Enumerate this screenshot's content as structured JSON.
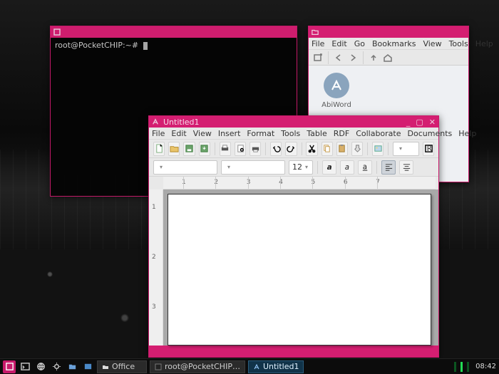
{
  "terminal": {
    "title_icon": "terminal-icon",
    "prompt": "root@PocketCHIP:~#"
  },
  "file_manager": {
    "menu": [
      "File",
      "Edit",
      "Go",
      "Bookmarks",
      "View",
      "Tools",
      "Help"
    ],
    "icons": {
      "app_label": "AbiWord"
    }
  },
  "abiword": {
    "title": "Untitled1",
    "menu": [
      "File",
      "Edit",
      "View",
      "Insert",
      "Format",
      "Tools",
      "Table",
      "RDF",
      "Collaborate",
      "Documents",
      "Help"
    ],
    "style_combo": "",
    "font_combo": "",
    "size_combo": "12",
    "zoom_combo": "",
    "status": {
      "mode": "",
      "lang": "",
      "ins": ""
    }
  },
  "ruler": {
    "marks": [
      1,
      2,
      3,
      4,
      5,
      6,
      7
    ]
  },
  "vruler": {
    "marks": [
      1,
      2,
      3
    ]
  },
  "panel": {
    "tasks": [
      {
        "label": "Office",
        "active": false
      },
      {
        "label": "root@PocketCHIP…",
        "active": false
      },
      {
        "label": "Untitled1",
        "active": true
      }
    ],
    "clock": "08:42"
  },
  "colors": {
    "accent": "#d41e71"
  }
}
